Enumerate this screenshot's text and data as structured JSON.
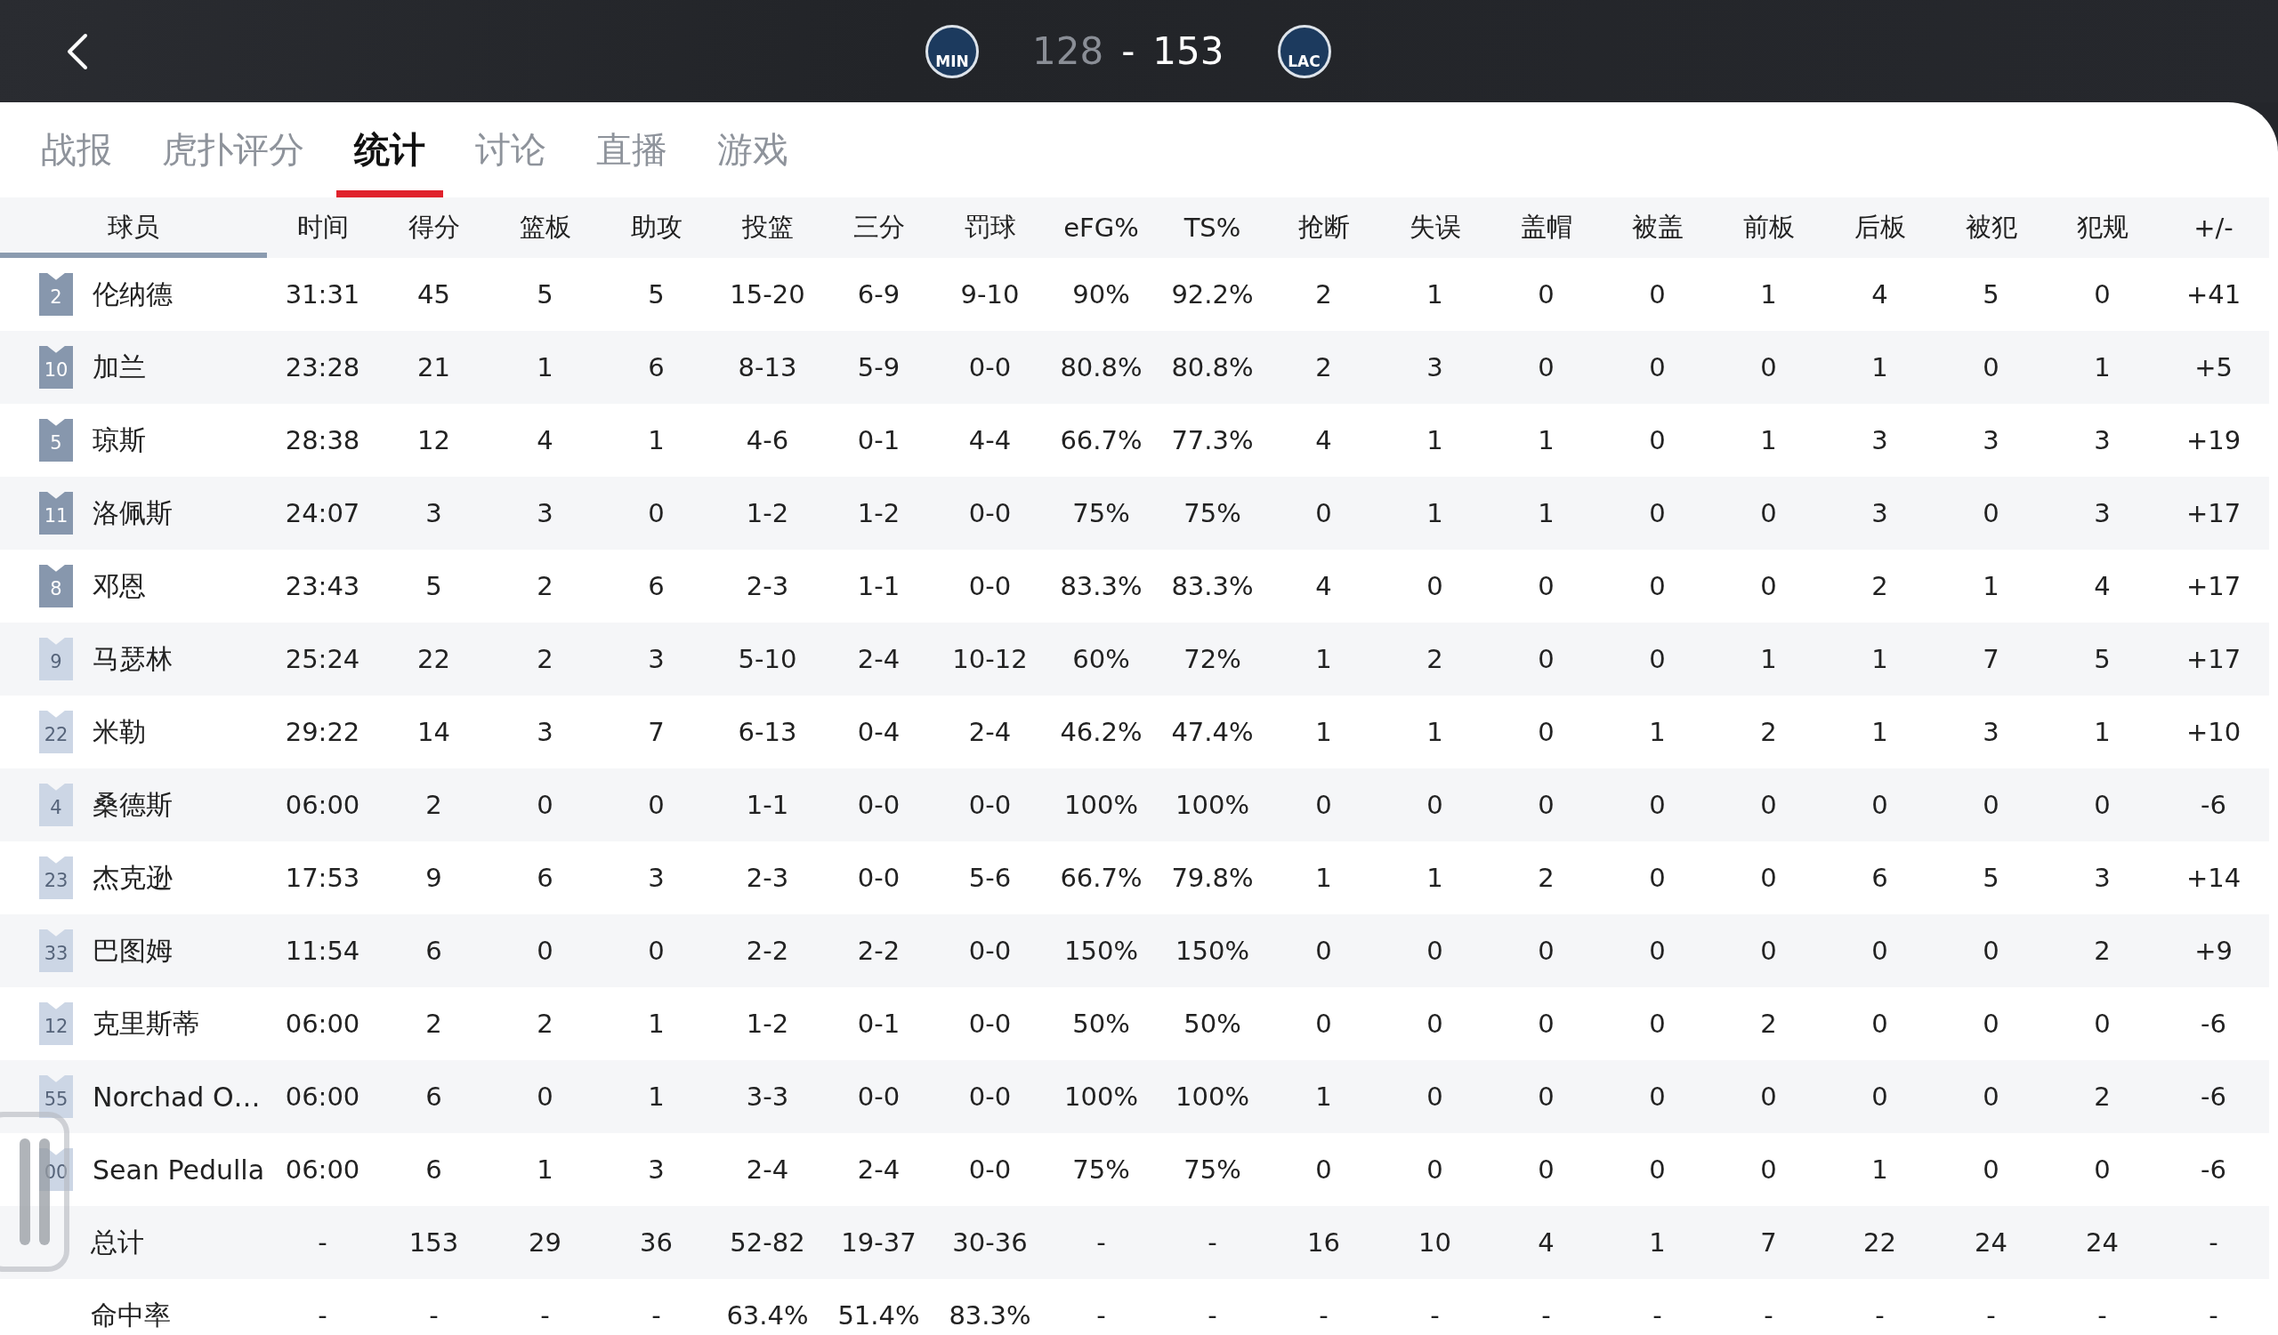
{
  "header": {
    "teams": [
      {
        "abbr": "MIN",
        "score": "128",
        "winner": false
      },
      {
        "abbr": "LAC",
        "score": "153",
        "winner": true
      }
    ],
    "separator": "-"
  },
  "tabs": [
    {
      "label": "战报",
      "selected": false
    },
    {
      "label": "虎扑评分",
      "selected": false
    },
    {
      "label": "统计",
      "selected": true
    },
    {
      "label": "讨论",
      "selected": false
    },
    {
      "label": "直播",
      "selected": false
    },
    {
      "label": "游戏",
      "selected": false
    }
  ],
  "table": {
    "columns": [
      "球员",
      "时间",
      "得分",
      "篮板",
      "助攻",
      "投篮",
      "三分",
      "罚球",
      "eFG%",
      "TS%",
      "抢断",
      "失误",
      "盖帽",
      "被盖",
      "前板",
      "后板",
      "被犯",
      "犯规",
      "+/-"
    ],
    "rows": [
      {
        "kind": "player",
        "number": "2",
        "starter": true,
        "name": "伦纳德",
        "stats": [
          "31:31",
          "45",
          "5",
          "5",
          "15-20",
          "6-9",
          "9-10",
          "90%",
          "92.2%",
          "2",
          "1",
          "0",
          "0",
          "1",
          "4",
          "5",
          "0",
          "+41"
        ]
      },
      {
        "kind": "player",
        "number": "10",
        "starter": true,
        "name": "加兰",
        "stats": [
          "23:28",
          "21",
          "1",
          "6",
          "8-13",
          "5-9",
          "0-0",
          "80.8%",
          "80.8%",
          "2",
          "3",
          "0",
          "0",
          "0",
          "1",
          "0",
          "1",
          "+5"
        ]
      },
      {
        "kind": "player",
        "number": "5",
        "starter": true,
        "name": "琼斯",
        "stats": [
          "28:38",
          "12",
          "4",
          "1",
          "4-6",
          "0-1",
          "4-4",
          "66.7%",
          "77.3%",
          "4",
          "1",
          "1",
          "0",
          "1",
          "3",
          "3",
          "3",
          "+19"
        ]
      },
      {
        "kind": "player",
        "number": "11",
        "starter": true,
        "name": "洛佩斯",
        "stats": [
          "24:07",
          "3",
          "3",
          "0",
          "1-2",
          "1-2",
          "0-0",
          "75%",
          "75%",
          "0",
          "1",
          "1",
          "0",
          "0",
          "3",
          "0",
          "3",
          "+17"
        ]
      },
      {
        "kind": "player",
        "number": "8",
        "starter": true,
        "name": "邓恩",
        "stats": [
          "23:43",
          "5",
          "2",
          "6",
          "2-3",
          "1-1",
          "0-0",
          "83.3%",
          "83.3%",
          "4",
          "0",
          "0",
          "0",
          "0",
          "2",
          "1",
          "4",
          "+17"
        ]
      },
      {
        "kind": "player",
        "number": "9",
        "starter": false,
        "name": "马瑟林",
        "stats": [
          "25:24",
          "22",
          "2",
          "3",
          "5-10",
          "2-4",
          "10-12",
          "60%",
          "72%",
          "1",
          "2",
          "0",
          "0",
          "1",
          "1",
          "7",
          "5",
          "+17"
        ]
      },
      {
        "kind": "player",
        "number": "22",
        "starter": false,
        "name": "米勒",
        "stats": [
          "29:22",
          "14",
          "3",
          "7",
          "6-13",
          "0-4",
          "2-4",
          "46.2%",
          "47.4%",
          "1",
          "1",
          "0",
          "1",
          "2",
          "1",
          "3",
          "1",
          "+10"
        ]
      },
      {
        "kind": "player",
        "number": "4",
        "starter": false,
        "name": "桑德斯",
        "stats": [
          "06:00",
          "2",
          "0",
          "0",
          "1-1",
          "0-0",
          "0-0",
          "100%",
          "100%",
          "0",
          "0",
          "0",
          "0",
          "0",
          "0",
          "0",
          "0",
          "-6"
        ]
      },
      {
        "kind": "player",
        "number": "23",
        "starter": false,
        "name": "杰克逊",
        "stats": [
          "17:53",
          "9",
          "6",
          "3",
          "2-3",
          "0-0",
          "5-6",
          "66.7%",
          "79.8%",
          "1",
          "1",
          "2",
          "0",
          "0",
          "6",
          "5",
          "3",
          "+14"
        ]
      },
      {
        "kind": "player",
        "number": "33",
        "starter": false,
        "name": "巴图姆",
        "stats": [
          "11:54",
          "6",
          "0",
          "0",
          "2-2",
          "2-2",
          "0-0",
          "150%",
          "150%",
          "0",
          "0",
          "0",
          "0",
          "0",
          "0",
          "0",
          "2",
          "+9"
        ]
      },
      {
        "kind": "player",
        "number": "12",
        "starter": false,
        "name": "克里斯蒂",
        "stats": [
          "06:00",
          "2",
          "2",
          "1",
          "1-2",
          "0-1",
          "0-0",
          "50%",
          "50%",
          "0",
          "0",
          "0",
          "0",
          "2",
          "0",
          "0",
          "0",
          "-6"
        ]
      },
      {
        "kind": "player",
        "number": "55",
        "starter": false,
        "name": "Norchad O…",
        "stats": [
          "06:00",
          "6",
          "0",
          "1",
          "3-3",
          "0-0",
          "0-0",
          "100%",
          "100%",
          "1",
          "0",
          "0",
          "0",
          "0",
          "0",
          "0",
          "2",
          "-6"
        ]
      },
      {
        "kind": "player",
        "number": "00",
        "starter": false,
        "name": "Sean Pedulla",
        "stats": [
          "06:00",
          "6",
          "1",
          "3",
          "2-4",
          "2-4",
          "0-0",
          "75%",
          "75%",
          "0",
          "0",
          "0",
          "0",
          "0",
          "1",
          "0",
          "0",
          "-6"
        ]
      },
      {
        "kind": "summary",
        "name": "总计",
        "stats": [
          "-",
          "153",
          "29",
          "36",
          "52-82",
          "19-37",
          "30-36",
          "-",
          "-",
          "16",
          "10",
          "4",
          "1",
          "7",
          "22",
          "24",
          "24",
          "-"
        ]
      },
      {
        "kind": "summary",
        "name": "命中率",
        "stats": [
          "-",
          "-",
          "-",
          "-",
          "63.4%",
          "51.4%",
          "83.3%",
          "-",
          "-",
          "-",
          "-",
          "-",
          "-",
          "-",
          "-",
          "-",
          "-",
          "-"
        ]
      }
    ]
  }
}
